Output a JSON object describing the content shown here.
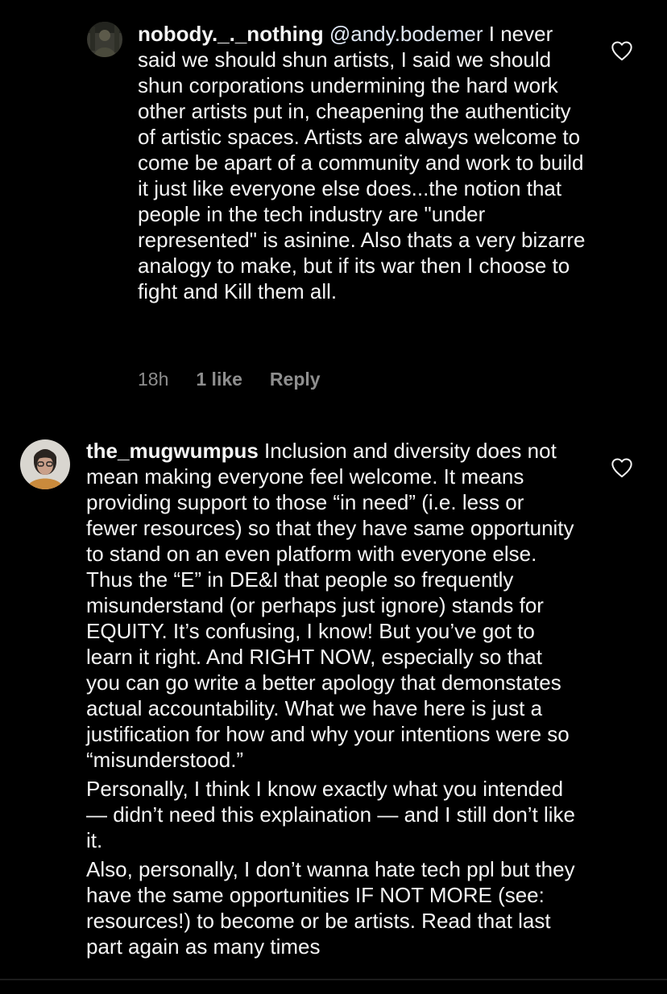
{
  "comments": [
    {
      "username": "nobody._._nothing",
      "mention": "@andy.bodemer",
      "paragraphs": [
        "I never said we should shun artists, I said we should shun corporations undermining the hard work other artists put in, cheapening the authenticity of artistic spaces. Artists are always welcome to come be apart of a community and work to build it just like everyone else does...the notion that people in the tech industry are \"under represented\" is asinine.  Also thats a very bizarre analogy to make, but if its war then I choose to fight and Kill them all."
      ],
      "time": "18h",
      "likes": "1 like",
      "reply": "Reply",
      "avatar_icon": "user-avatar-photo",
      "like_icon": "heart-outline-icon"
    },
    {
      "username": "the_mugwumpus",
      "paragraphs": [
        "Inclusion and diversity does not mean making everyone feel welcome. It means providing support to those “in need” (i.e. less or fewer resources) so that they have same opportunity to stand on an even platform with everyone else. Thus the “E” in DE&I that people so frequently misunderstand (or perhaps just ignore) stands for EQUITY. It’s confusing, I know! But you’ve got to learn it right. And RIGHT NOW, especially so that you can go write a better apology that demonstates actual accountability. What we have here is just a justification for how and why your intentions were so “misunderstood.”",
        "Personally, I think I know exactly what you intended — didn’t need this explaination — and I still don’t like it.",
        "Also, personally, I don’t wanna hate tech ppl but they have the same opportunities IF NOT MORE (see: resources!) to become or be artists. Read that last part again as many times"
      ],
      "avatar_icon": "user-avatar-photo",
      "like_icon": "heart-outline-icon"
    }
  ],
  "colors": {
    "background": "#000000",
    "text": "#f5f5f5",
    "meta": "#8e8e8e"
  }
}
